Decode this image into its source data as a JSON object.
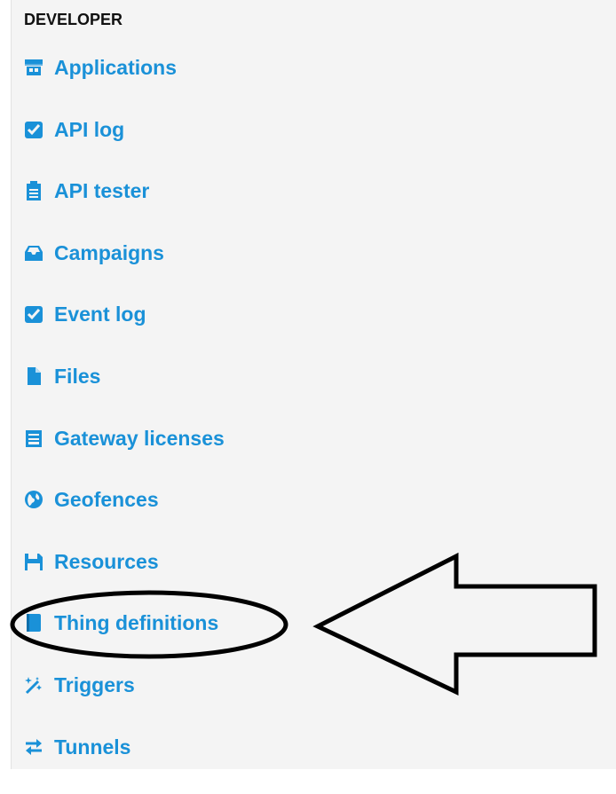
{
  "section": {
    "title": "DEVELOPER"
  },
  "nav": {
    "items": [
      {
        "label": "Applications",
        "icon": "store-icon"
      },
      {
        "label": "API log",
        "icon": "checkbox-icon"
      },
      {
        "label": "API tester",
        "icon": "clipboard-icon"
      },
      {
        "label": "Campaigns",
        "icon": "inbox-icon"
      },
      {
        "label": "Event log",
        "icon": "checkbox-icon"
      },
      {
        "label": "Files",
        "icon": "file-icon"
      },
      {
        "label": "Gateway licenses",
        "icon": "newspaper-icon"
      },
      {
        "label": "Geofences",
        "icon": "globe-icon"
      },
      {
        "label": "Resources",
        "icon": "save-icon"
      },
      {
        "label": "Thing definitions",
        "icon": "book-icon"
      },
      {
        "label": "Triggers",
        "icon": "magic-wand-icon"
      },
      {
        "label": "Tunnels",
        "icon": "exchange-icon"
      }
    ]
  },
  "colors": {
    "link": "#1a91d8",
    "background": "#f4f4f4",
    "annotation": "#000000"
  }
}
